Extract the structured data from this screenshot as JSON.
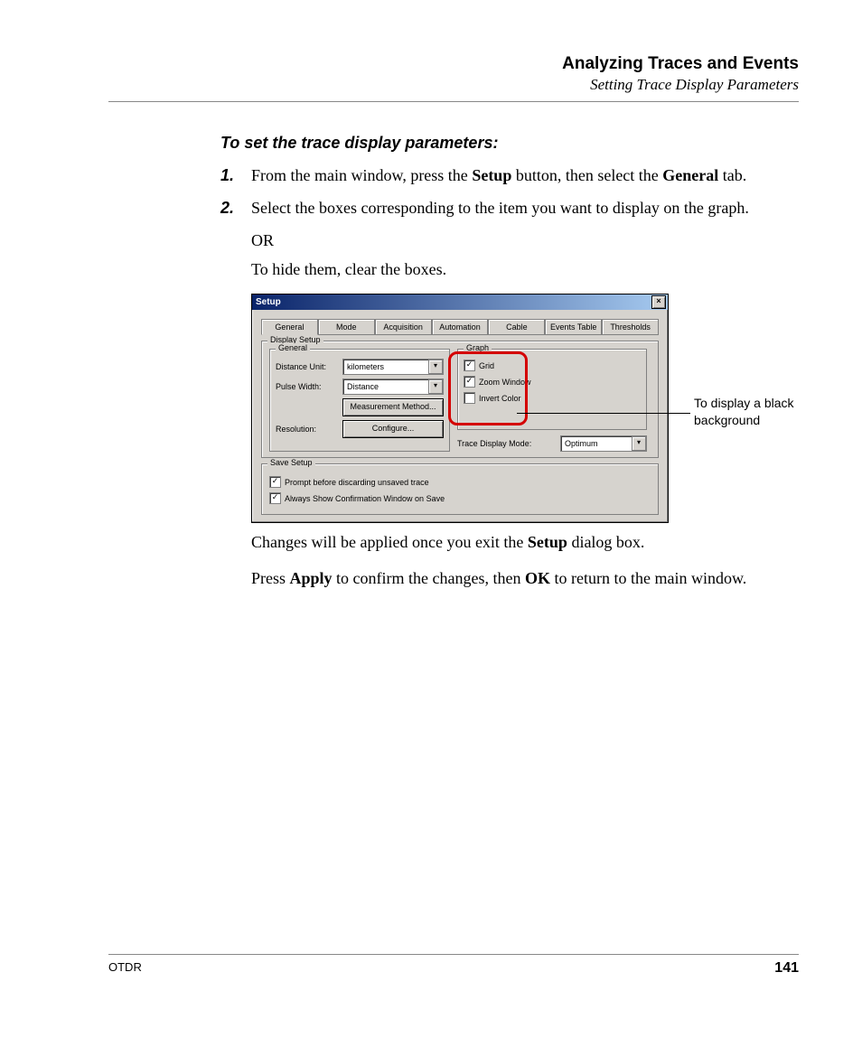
{
  "header": {
    "chapter": "Analyzing Traces and Events",
    "section": "Setting Trace Display Parameters"
  },
  "procedure": {
    "heading": "To set the trace display parameters:",
    "step1_num": "1.",
    "step1_a": "From the main window, press the ",
    "step1_b": "Setup",
    "step1_c": " button, then select the ",
    "step1_d": "General",
    "step1_e": " tab.",
    "step2_num": "2.",
    "step2_a": "Select the boxes corresponding to the item you want to display on the graph.",
    "or": "OR",
    "hide": "To hide them, clear the boxes."
  },
  "screenshot": {
    "title": "Setup",
    "close": "×",
    "tabs": [
      "General",
      "Mode",
      "Acquisition",
      "Automation",
      "Cable",
      "Events Table",
      "Thresholds"
    ],
    "group_display": "Display Setup",
    "group_general": "General",
    "group_graph": "Graph",
    "distance_label": "Distance Unit:",
    "distance_value": "kilometers",
    "pulse_label": "Pulse Width:",
    "pulse_value": "Distance",
    "meas_btn": "Measurement Method...",
    "resolution_label": "Resolution:",
    "configure_btn": "Configure...",
    "chk_grid": "Grid",
    "chk_zoom": "Zoom Window",
    "chk_invert": "Invert Color",
    "trace_mode_label": "Trace Display Mode:",
    "trace_mode_value": "Optimum",
    "group_save": "Save Setup",
    "chk_prompt": "Prompt before discarding unsaved trace",
    "chk_confirm": "Always Show Confirmation Window on Save",
    "callout": "To display a black background"
  },
  "after": {
    "p1_a": "Changes will be applied once you exit the ",
    "p1_b": "Setup",
    "p1_c": " dialog box.",
    "p2_a": "Press ",
    "p2_b": "Apply",
    "p2_c": " to confirm the changes, then ",
    "p2_d": "OK",
    "p2_e": " to return to the main window."
  },
  "footer": {
    "product": "OTDR",
    "page": "141"
  }
}
